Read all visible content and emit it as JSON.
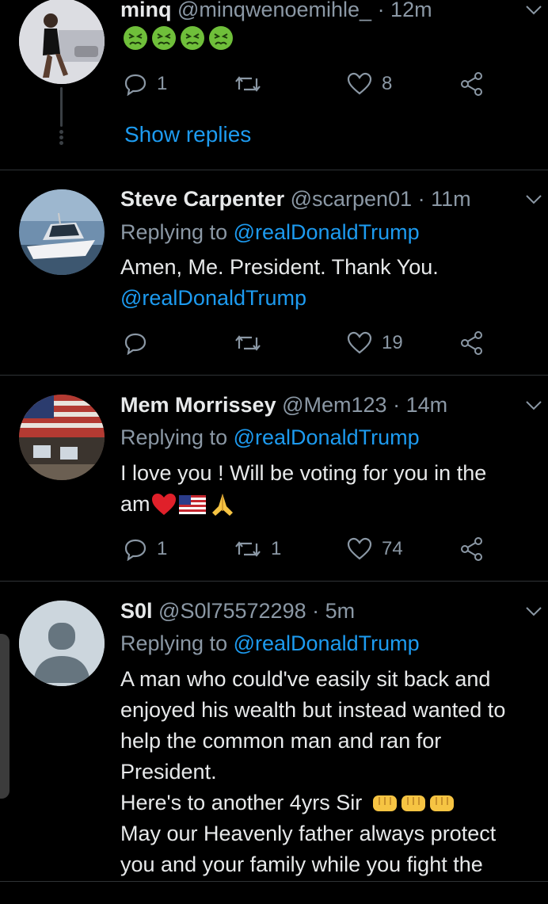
{
  "tweets": [
    {
      "name": "minq",
      "handle": "@minqwenoemihle_",
      "time": "· 12m",
      "emoji": [
        "😖",
        "😖",
        "😖",
        "😖"
      ],
      "replies": "1",
      "retweets": "",
      "likes": "8",
      "show_replies": "Show replies"
    },
    {
      "name": "Steve Carpenter",
      "handle": "@scarpen01",
      "time": "· 11m",
      "replying_prefix": "Replying to",
      "replying_to": "@realDonaldTrump",
      "text": "Amen, Me. President.  Thank You.",
      "text_mention": "@realDonaldTrump",
      "replies": "",
      "retweets": "",
      "likes": "19"
    },
    {
      "name": "Mem Morrissey",
      "handle": "@Mem123",
      "time": "· 14m",
      "replying_prefix": "Replying to",
      "replying_to": "@realDonaldTrump",
      "text_line1": "I love you !  Will be voting for you in the",
      "text_line2": "am",
      "emoji": [
        "❤️",
        "🇺🇸",
        "🙏"
      ],
      "replies": "1",
      "retweets": "1",
      "likes": "74"
    },
    {
      "name": "S0l",
      "handle": "@S0l75572298",
      "time": "· 5m",
      "replying_prefix": "Replying to",
      "replying_to": "@realDonaldTrump",
      "lines": [
        "A man who could've easily sit back and",
        "enjoyed his wealth but instead wanted to",
        "help the common man and ran for",
        "President.",
        "Here's to another 4yrs Sir",
        "May our Heavenly father always protect",
        "you and your family while you fight the"
      ],
      "fist_emoji": [
        "👊",
        "👊",
        "👊"
      ]
    }
  ],
  "colors": {
    "background": "#000000",
    "text": "#e7e9ea",
    "muted": "#8b98a5",
    "link": "#1d9bf0",
    "separator": "#2f3336"
  },
  "icons": [
    "reply-icon",
    "retweet-icon",
    "like-icon",
    "share-icon",
    "chevron-down-icon",
    "sick-face-emoji",
    "heart-emoji",
    "us-flag-emoji",
    "praying-hands-emoji",
    "fist-emoji",
    "default-avatar-icon"
  ]
}
